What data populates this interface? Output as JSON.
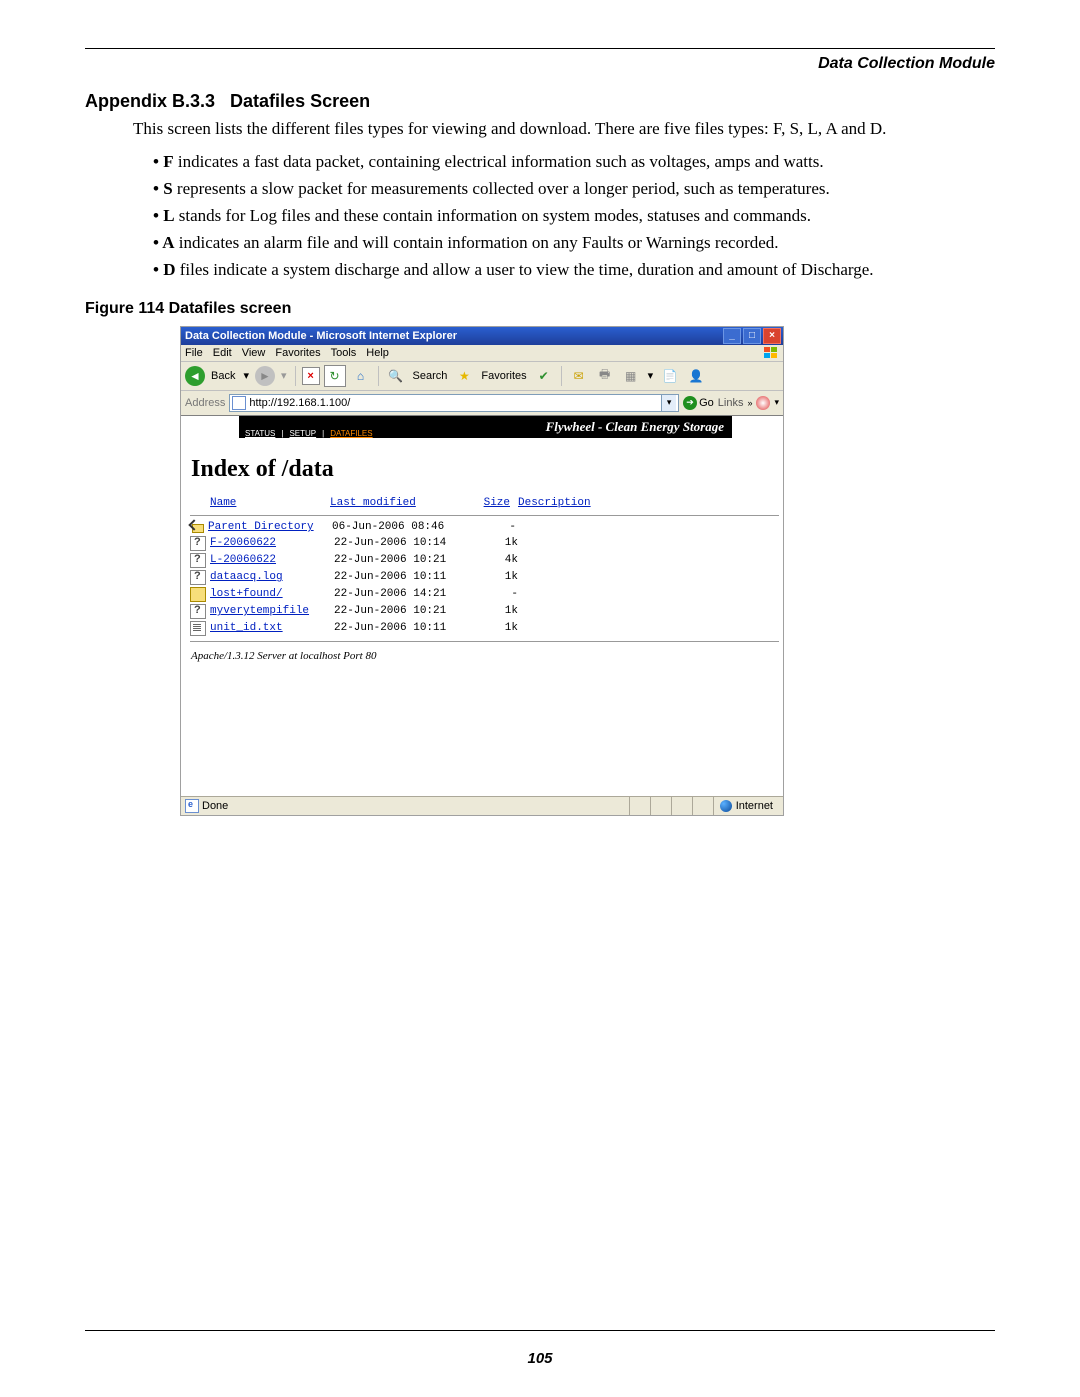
{
  "header": {
    "module": "Data Collection Module"
  },
  "section": {
    "number": "Appendix B.3.3",
    "title": "Datafiles Screen",
    "intro": "This screen lists the different files types for viewing and download. There are five files types: F, S, L, A and D.",
    "bullets": [
      {
        "letter": "F",
        "text": " indicates a fast data packet, containing electrical information such as voltages, amps and watts."
      },
      {
        "letter": "S",
        "text": " represents a slow packet for measurements collected over a longer period, such as temperatures."
      },
      {
        "letter": "L",
        "text": " stands for Log files and these contain information on system modes, statuses and commands."
      },
      {
        "letter": "A",
        "text": " indicates an alarm file and will contain information on any Faults or Warnings recorded."
      },
      {
        "letter": "D",
        "text": " files indicate a system discharge and allow a user to view the time, duration and amount of Discharge."
      }
    ]
  },
  "figure": {
    "label": "Figure 114",
    "title": "Datafiles screen"
  },
  "ie": {
    "title": "Data Collection Module - Microsoft Internet Explorer",
    "menu": [
      "File",
      "Edit",
      "View",
      "Favorites",
      "Tools",
      "Help"
    ],
    "toolbar": {
      "back": "Back",
      "search": "Search",
      "favorites": "Favorites"
    },
    "address": {
      "label": "Address",
      "url": "http://192.168.1.100/",
      "go": "Go",
      "links": "Links"
    },
    "banner": {
      "brand": "Flywheel - Clean Energy Storage",
      "tabs": {
        "status": "STATUS",
        "setup": "SETUP",
        "datafiles": "DATAFILES"
      }
    },
    "page": {
      "heading": "Index of /data",
      "cols": {
        "name": "Name",
        "modified": "Last modified",
        "size": "Size",
        "desc": "Description"
      },
      "rows": [
        {
          "icon": "back",
          "name": "Parent Directory",
          "modified": "06-Jun-2006 08:46",
          "size": "-"
        },
        {
          "icon": "unk",
          "name": "F-20060622",
          "modified": "22-Jun-2006 10:14",
          "size": "1k"
        },
        {
          "icon": "unk",
          "name": "L-20060622",
          "modified": "22-Jun-2006 10:21",
          "size": "4k"
        },
        {
          "icon": "unk",
          "name": "dataacq.log",
          "modified": "22-Jun-2006 10:11",
          "size": "1k"
        },
        {
          "icon": "dir",
          "name": "lost+found/",
          "modified": "22-Jun-2006 14:21",
          "size": "-"
        },
        {
          "icon": "unk",
          "name": "myverytempifile",
          "modified": "22-Jun-2006 10:21",
          "size": "1k"
        },
        {
          "icon": "txt",
          "name": "unit_id.txt",
          "modified": "22-Jun-2006 10:11",
          "size": "1k"
        }
      ],
      "server": "Apache/1.3.12 Server at localhost Port 80"
    },
    "status": {
      "done": "Done",
      "zone": "Internet"
    }
  },
  "footer": {
    "page_number": "105"
  }
}
